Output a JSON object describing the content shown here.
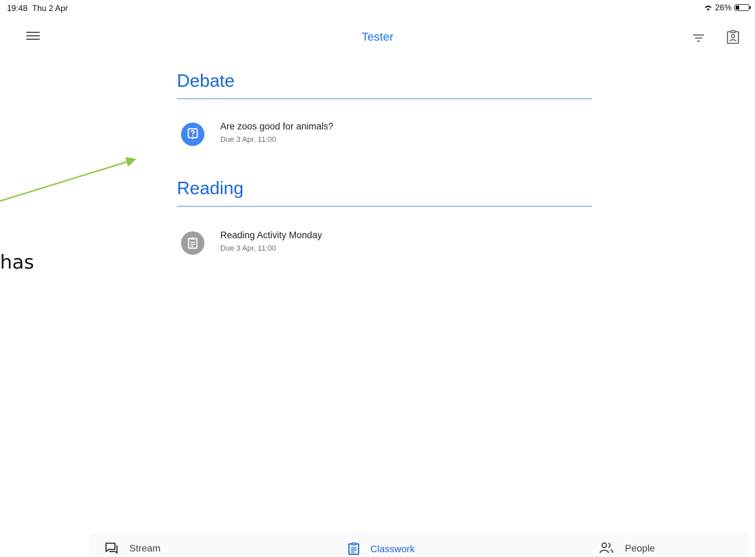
{
  "status_bar": {
    "time": "19:48",
    "date": "Thu 2 Apr",
    "battery": "26%",
    "battery_level": 0.26
  },
  "app_bar": {
    "title": "Tester",
    "menu_icon": "menu-icon",
    "filter_icon": "filter-icon",
    "profile_icon": "assignment-ind-icon"
  },
  "topics": [
    {
      "name": "Debate",
      "items": [
        {
          "title": "Are zoos good for animals?",
          "due": "Due 3 Apr, 11:00",
          "icon": "question-icon",
          "icon_color": "#4285f4"
        }
      ]
    },
    {
      "name": "Reading",
      "items": [
        {
          "title": "Reading Activity Monday",
          "due": "Due 3 Apr, 11:00",
          "icon": "assignment-icon",
          "icon_color": "#9e9e9e"
        }
      ]
    }
  ],
  "annotation": {
    "text": "has",
    "arrow_color": "#8dc63f"
  },
  "bottom_nav": {
    "tabs": [
      {
        "label": "Stream",
        "icon": "stream-icon",
        "active": false
      },
      {
        "label": "Classwork",
        "icon": "classwork-icon",
        "active": true
      },
      {
        "label": "People",
        "icon": "people-icon",
        "active": false
      }
    ]
  },
  "colors": {
    "accent": "#1a73e8",
    "topic_text": "#1967d2"
  }
}
